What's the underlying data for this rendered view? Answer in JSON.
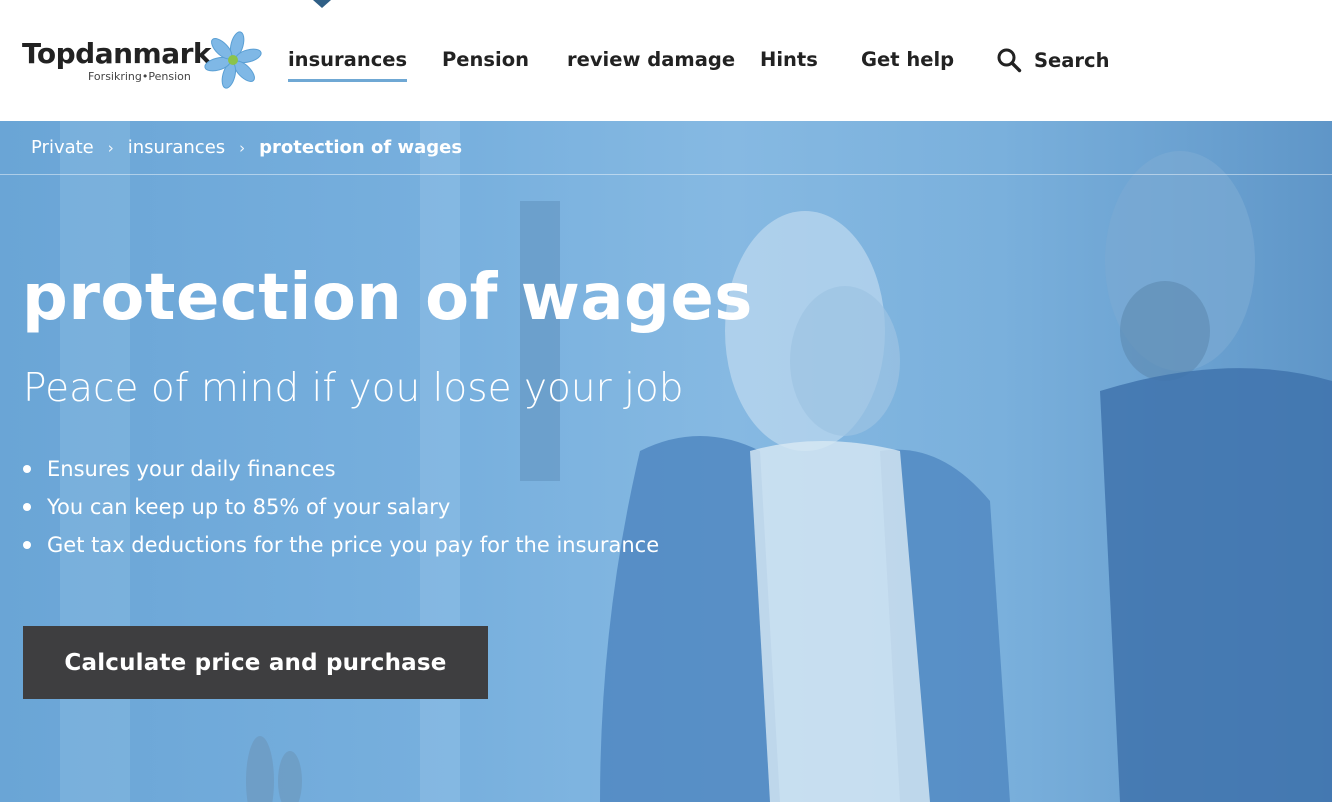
{
  "brand": {
    "name": "Topdanmark",
    "tagline": "Forsikring•Pension",
    "colors": {
      "accent": "#6fa8d4",
      "hero": "#78b0de",
      "cta": "#3e3e40",
      "flower_petal": "#7fb8e6",
      "flower_center": "#8bc34a"
    }
  },
  "nav": {
    "items": [
      {
        "label": "insurances",
        "active": true
      },
      {
        "label": "Pension"
      },
      {
        "label": "review damage"
      },
      {
        "label": "Hints"
      },
      {
        "label": "Get help"
      }
    ],
    "search_label": "Search"
  },
  "breadcrumb": {
    "items": [
      "Private",
      "insurances",
      "protection of wages"
    ],
    "separator": "›"
  },
  "hero": {
    "title": "protection of wages",
    "subtitle": "Peace of mind if you lose your job",
    "bullets": [
      "Ensures your daily finances",
      "You can keep up to 85% of your salary",
      "Get tax deductions for the price you pay for the insurance"
    ],
    "cta_label": "Calculate price and purchase"
  }
}
